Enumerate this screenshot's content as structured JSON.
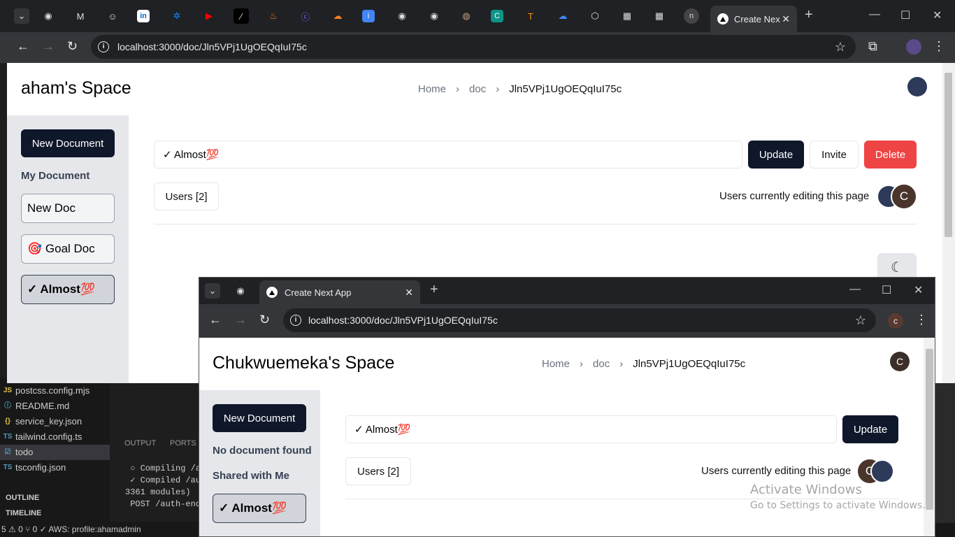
{
  "browser": {
    "active_tab_title": "Create Nex",
    "url": "localhost:3000/doc/Jln5VPj1UgOEQqIuI75c",
    "tab_icons": [
      "chevron-down-icon",
      "globe-icon",
      "gmail-icon",
      "chat-icon",
      "linkedin-icon",
      "bluesky-icon",
      "youtube-icon",
      "notion-icon",
      "fire-icon",
      "c-icon",
      "cloudflare-icon",
      "info-icon",
      "globe-icon",
      "globe-icon",
      "cookie-icon",
      "c-icon",
      "tensorflow-icon",
      "cloud-icon",
      "cube-icon",
      "grid-icon",
      "grid-icon",
      "n-icon"
    ]
  },
  "app": {
    "space_title": "aham's Space",
    "breadcrumb": {
      "home": "Home",
      "doc": "doc",
      "current": "Jln5VPj1UgOEQqIuI75c"
    },
    "new_document": "New Document",
    "my_document": "My Document",
    "docs": [
      "New Doc",
      "🎯 Goal Doc",
      "✓ Almost💯"
    ],
    "title_value": "✓ Almost💯",
    "update": "Update",
    "invite": "Invite",
    "delete": "Delete",
    "users": "Users [2]",
    "editing": "Users currently editing this page",
    "avatar_letter": "C"
  },
  "second_browser": {
    "tab_title": "Create Next App",
    "url": "localhost:3000/doc/Jln5VPj1UgOEQqIuI75c",
    "profile_letter": "c",
    "space_title": "Chukwuemeka's Space",
    "breadcrumb": {
      "home": "Home",
      "doc": "doc",
      "current": "Jln5VPj1UgOEQqIuI75c"
    },
    "new_document": "New Document",
    "no_doc": "No document found",
    "shared": "Shared with Me",
    "shared_doc": "✓ Almost💯",
    "title_value": "✓ Almost💯",
    "update": "Update",
    "users": "Users [2]",
    "editing": "Users currently editing this page",
    "avatar_letter": "C",
    "avatar_letter2": "C"
  },
  "vscode": {
    "files": [
      "postcss.config.mjs",
      "README.md",
      "service_key.json",
      "tailwind.config.ts",
      "todo",
      "tsconfig.json"
    ],
    "file_icons": [
      "JS",
      "ⓘ",
      "{}",
      "TS",
      "☑",
      "TS"
    ],
    "sections": [
      "OUTLINE",
      "TIMELINE"
    ],
    "panel_tabs": [
      "OUTPUT",
      "PORTS"
    ],
    "terminal": " ○ Compiling /a\n ✓ Compiled /au\n3361 modules)\n POST /auth-end",
    "status": "5 ⚠ 0   ⑂ 0   ✓ AWS: profile:ahamadmin"
  },
  "windows_watermark": {
    "line1": "Activate Windows",
    "line2": "Go to Settings to activate Windows."
  }
}
